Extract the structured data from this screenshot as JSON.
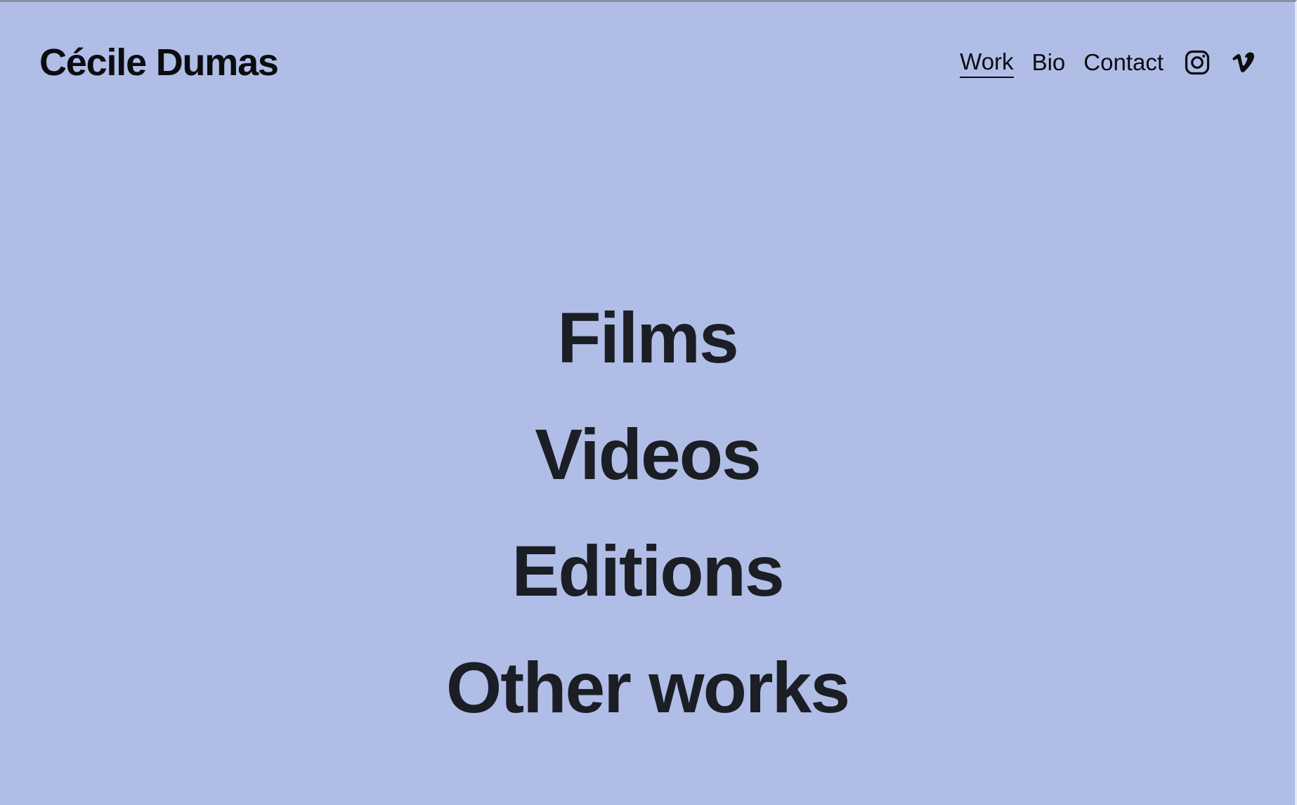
{
  "header": {
    "site_title": "Cécile Dumas",
    "nav": [
      {
        "label": "Work",
        "active": true
      },
      {
        "label": "Bio",
        "active": false
      },
      {
        "label": "Contact",
        "active": false
      }
    ],
    "social_icons": [
      "instagram-icon",
      "vimeo-icon"
    ]
  },
  "main": {
    "menu": [
      {
        "label": "Films"
      },
      {
        "label": "Videos"
      },
      {
        "label": "Editions"
      },
      {
        "label": "Other works"
      }
    ]
  },
  "colors": {
    "background": "#b0bee7",
    "text": "#1c1e25"
  }
}
